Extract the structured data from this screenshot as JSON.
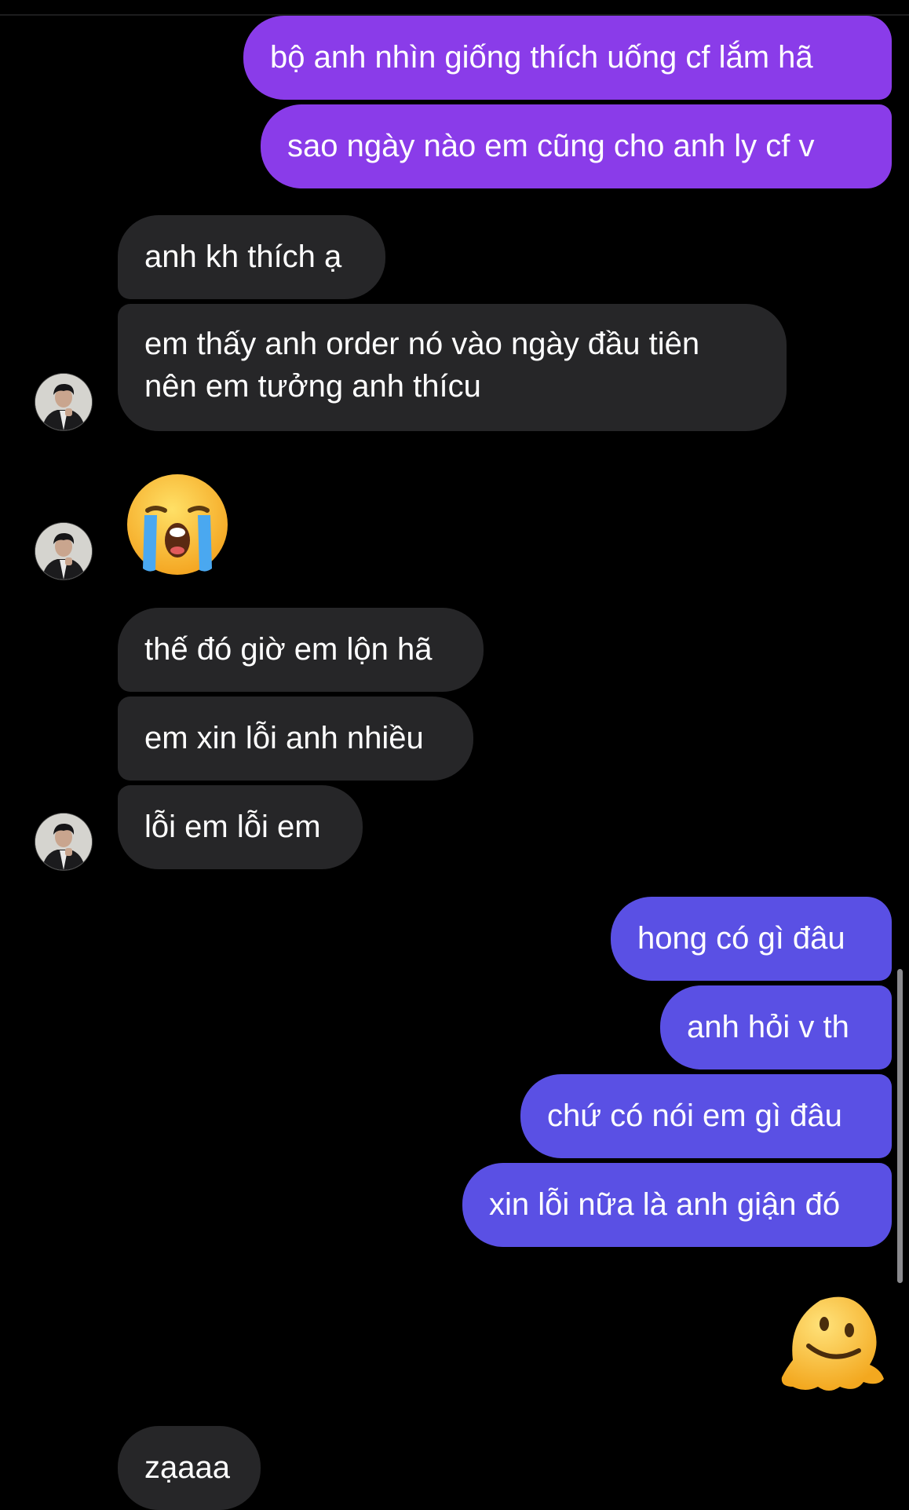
{
  "conversation": {
    "messages": [
      {
        "id": "m1",
        "sender": "me",
        "text": "bộ anh nhìn giống thích uống cf lắm hã"
      },
      {
        "id": "m2",
        "sender": "me",
        "text": "sao ngày nào em cũng cho anh ly cf v"
      },
      {
        "id": "m3",
        "sender": "them",
        "text": "anh kh thích ạ"
      },
      {
        "id": "m4",
        "sender": "them",
        "text": "em thấy anh order nó vào ngày đầu tiên nên em tưởng anh thícu"
      },
      {
        "id": "m5",
        "sender": "them",
        "emoji": "loudly-crying-face"
      },
      {
        "id": "m6",
        "sender": "them",
        "text": "thế đó giờ em lộn hã"
      },
      {
        "id": "m7",
        "sender": "them",
        "text": "em xin lỗi anh nhiều"
      },
      {
        "id": "m8",
        "sender": "them",
        "text": "lỗi em lỗi em"
      },
      {
        "id": "m9",
        "sender": "me",
        "text": "hong có gì đâu"
      },
      {
        "id": "m10",
        "sender": "me",
        "text": "anh hỏi v th"
      },
      {
        "id": "m11",
        "sender": "me",
        "text": "chứ có nói em gì đâu"
      },
      {
        "id": "m12",
        "sender": "me",
        "text": "xin lỗi nữa là anh giận đó"
      },
      {
        "id": "m13",
        "sender": "me",
        "emoji": "melting-face"
      },
      {
        "id": "m14",
        "sender": "them",
        "text": "zạaaa"
      }
    ]
  },
  "colors": {
    "background": "#000000",
    "outgoing_bubble_top": "#8a3ce9",
    "outgoing_bubble_bottom": "#5a50e4",
    "incoming_bubble": "#262628",
    "text": "#ffffff"
  },
  "icons": {
    "contact_avatar": "contact-avatar",
    "sob_emoji": "loudly-crying-face",
    "melt_emoji": "melting-face"
  }
}
